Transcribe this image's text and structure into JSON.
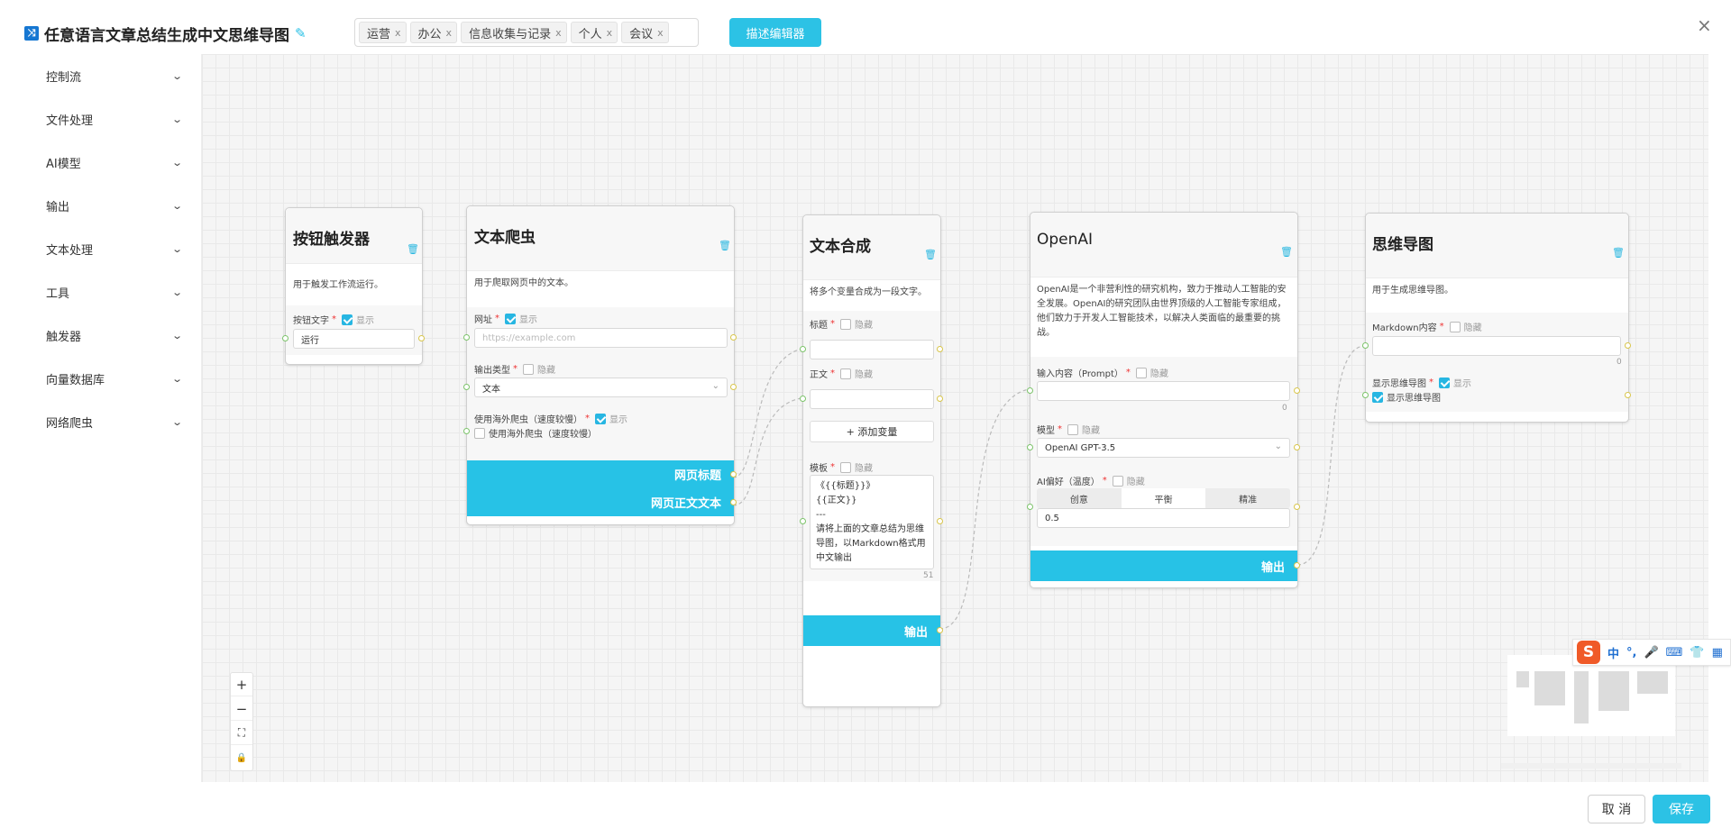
{
  "header": {
    "title": "任意语言文章总结生成中文思维导图",
    "tags": [
      "运营",
      "办公",
      "信息收集与记录",
      "个人",
      "会议"
    ],
    "tag_remove": "x",
    "describe_button": "描述编辑器",
    "close": "×"
  },
  "sidebar": {
    "items": [
      "控制流",
      "文件处理",
      "AI模型",
      "输出",
      "文本处理",
      "工具",
      "触发器",
      "向量数据库",
      "网络爬虫"
    ]
  },
  "nodes": {
    "trigger": {
      "title": "按钮触发器",
      "desc": "用于触发工作流运行。",
      "button_text_label": "按钮文字",
      "show_label": "显示",
      "button_text_value": "运行"
    },
    "crawler": {
      "title": "文本爬虫",
      "desc": "用于爬取网页中的文本。",
      "url_label": "网址",
      "show_label": "显示",
      "url_placeholder": "https://example.com",
      "output_type_label": "输出类型",
      "hide_label": "隐藏",
      "output_type_value": "文本",
      "proxy_label": "使用海外爬虫（速度较慢）",
      "proxy_checkbox_label": "使用海外爬虫（速度较慢）",
      "out_title": "网页标题",
      "out_body": "网页正文文本"
    },
    "text_merge": {
      "title": "文本合成",
      "desc": "将多个变量合成为一段文字。",
      "title_var_label": "标题",
      "body_var_label": "正文",
      "hide_label": "隐藏",
      "add_var_button": "+ 添加变量",
      "template_label": "模板",
      "template_value": "《{{标题}}》\n{{正文}}\n---\n请将上面的文章总结为思维导图，以Markdown格式用中文输出",
      "template_count": "51",
      "output": "输出"
    },
    "openai": {
      "title": "OpenAI",
      "desc": "OpenAI是一个非营利性的研究机构，致力于推动人工智能的安全发展。OpenAI的研究团队由世界顶级的人工智能专家组成，他们致力于开发人工智能技术，以解决人类面临的最重要的挑战。",
      "prompt_label": "输入内容（Prompt）",
      "hide_label": "隐藏",
      "prompt_count": "0",
      "model_label": "模型",
      "model_value": "OpenAI GPT-3.5",
      "temp_label": "AI偏好（温度）",
      "temp_options": [
        "创意",
        "平衡",
        "精准"
      ],
      "temp_value": "0.5",
      "output": "输出"
    },
    "mindmap": {
      "title": "思维导图",
      "desc": "用于生成思维导图。",
      "markdown_label": "Markdown内容",
      "hide_label": "隐藏",
      "markdown_count": "0",
      "show_map_label": "显示思维导图",
      "show_label": "显示",
      "show_map_checkbox_label": "显示思维导图"
    }
  },
  "zoom_controls": [
    "+",
    "−",
    "⛶",
    "🔒"
  ],
  "ime": {
    "logo": "S",
    "lang": "中"
  },
  "footer": {
    "cancel": "取 消",
    "save": "保存"
  },
  "colors": {
    "accent": "#2cc2e5",
    "brand_icon": "#1677d2"
  }
}
